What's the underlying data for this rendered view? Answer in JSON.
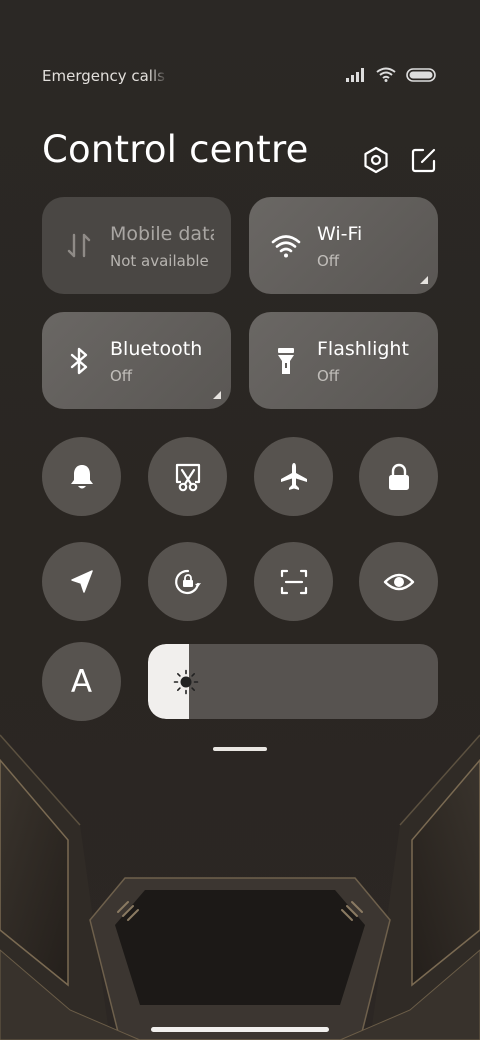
{
  "status_bar": {
    "carrier_text": "Emergency calls o",
    "icons": [
      "signal-icon",
      "wifi-icon",
      "battery-icon"
    ]
  },
  "header": {
    "title": "Control centre",
    "settings_icon": "settings-hex-icon",
    "edit_icon": "edit-icon"
  },
  "tiles": [
    {
      "label": "Mobile data",
      "sub": "Not available",
      "icon": "mobile-data-icon",
      "state": "unavailable"
    },
    {
      "label": "Wi-Fi",
      "sub": "Off",
      "icon": "wifi-icon",
      "state": "off"
    },
    {
      "label": "Bluetooth",
      "sub": "Off",
      "icon": "bluetooth-icon",
      "state": "off"
    },
    {
      "label": "Flashlight",
      "sub": "Off",
      "icon": "flashlight-icon",
      "state": "off"
    }
  ],
  "toggles_row1": [
    "bell-icon",
    "screenshot-scissors-icon",
    "airplane-icon",
    "lock-icon"
  ],
  "toggles_row2": [
    "location-icon",
    "rotation-lock-icon",
    "scan-icon",
    "eye-icon"
  ],
  "font_toggle": {
    "letter": "A",
    "icon": "font-size-icon"
  },
  "brightness": {
    "level": 0.14,
    "icon": "brightness-icon"
  },
  "colors": {
    "tile_active": "#66625f",
    "tile_dim": "#4a4744",
    "round": "#57534f",
    "slider_fill": "#f1efed",
    "background": "#2a2622"
  }
}
